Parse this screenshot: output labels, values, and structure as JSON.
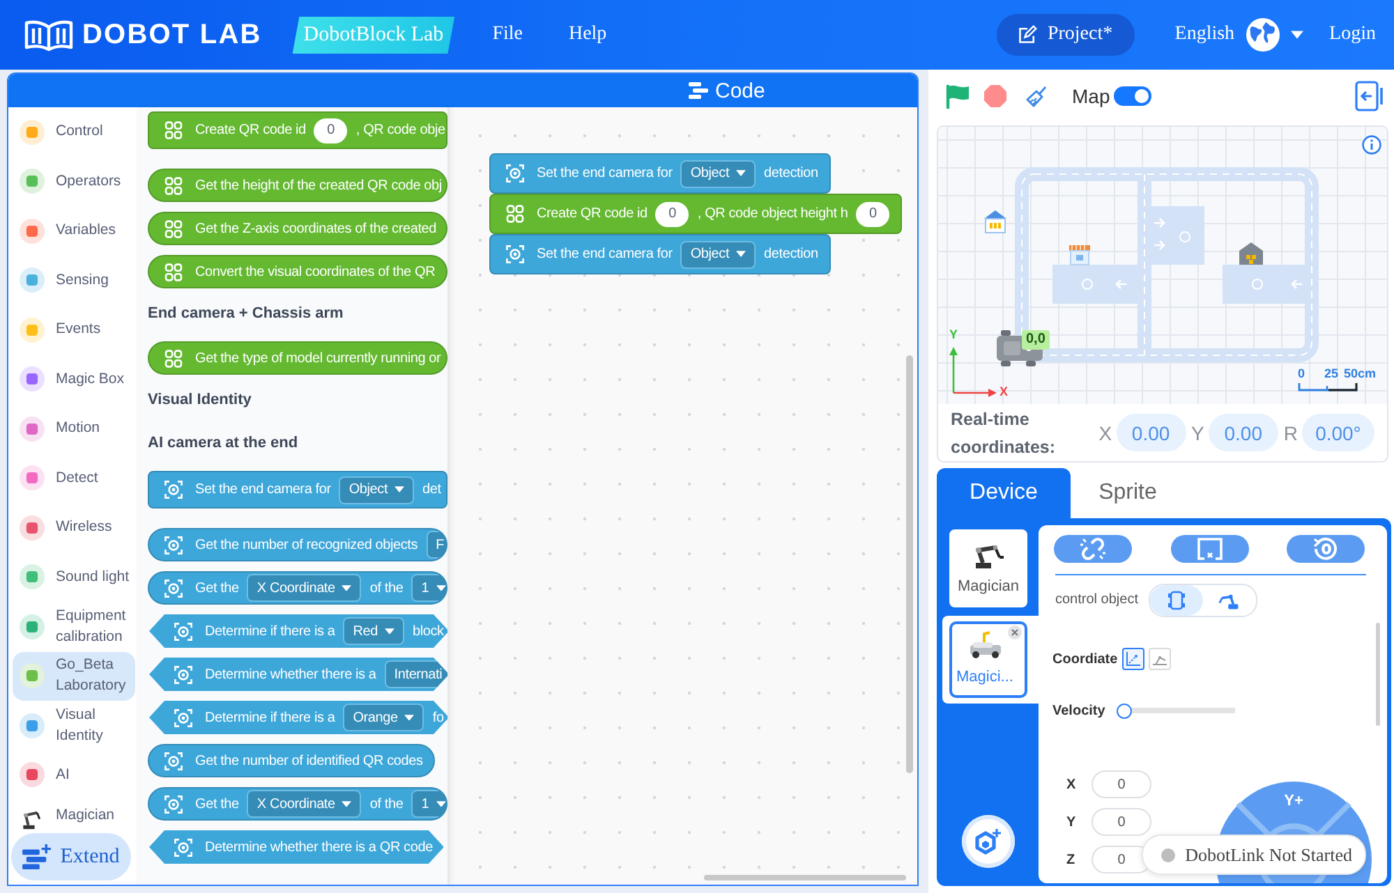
{
  "header": {
    "logo": "DOBOT LAB",
    "badge": "DobotBlock Lab",
    "menu": [
      {
        "label": "File"
      },
      {
        "label": "Help"
      }
    ],
    "project": "Project*",
    "language": "English",
    "login": "Login"
  },
  "code_panel": {
    "title": "Code"
  },
  "categories": [
    {
      "label": "Control",
      "kind": "badge",
      "color": "#ffab19",
      "selected": false
    },
    {
      "label": "Operators",
      "kind": "badge",
      "color": "#59c059",
      "selected": false
    },
    {
      "label": "Variables",
      "kind": "badge",
      "color": "#ff6b4a",
      "selected": false
    },
    {
      "label": "Sensing",
      "kind": "badge",
      "color": "#4cb0de",
      "selected": false
    },
    {
      "label": "Events",
      "kind": "badge",
      "color": "#ffbf1a",
      "selected": false
    },
    {
      "label": "Magic Box",
      "kind": "badge",
      "color": "#9966ff",
      "selected": false
    },
    {
      "label": "Motion",
      "kind": "badge",
      "color": "#e067c6",
      "selected": false
    },
    {
      "label": "Detect",
      "kind": "badge",
      "color": "#f26bc1",
      "selected": false
    },
    {
      "label": "Wireless",
      "kind": "badge",
      "color": "#e8546b",
      "selected": false
    },
    {
      "label": "Sound light",
      "kind": "badge",
      "color": "#3fbf7a",
      "selected": false
    },
    {
      "label": "Equipment calibration",
      "kind": "badge",
      "color": "#2db37a",
      "selected": false
    },
    {
      "label": "Go_Beta Laboratory",
      "kind": "badge",
      "color": "#6cc04a",
      "selected": true
    },
    {
      "label": "Visual Identity",
      "kind": "badge",
      "color": "#3d9ee8",
      "selected": false
    },
    {
      "label": "AI",
      "kind": "badge",
      "color": "#e8485f",
      "selected": false
    },
    {
      "label": "Magician",
      "kind": "robot",
      "selected": false
    }
  ],
  "extend_button": {
    "label": "Extend"
  },
  "palette": [
    {
      "kind": "qr_stack",
      "color": "#64b931",
      "parts": [
        {
          "kind": "text",
          "text": "Create QR code id"
        },
        {
          "kind": "number",
          "text": "0"
        },
        {
          "kind": "text",
          "text": ", QR code obje"
        }
      ]
    },
    {
      "kind": "qr_reporter",
      "color": "#64b931",
      "parts": [
        {
          "kind": "text",
          "text": "Get the height of the created QR code obj"
        }
      ]
    },
    {
      "kind": "qr_reporter",
      "color": "#64b931",
      "parts": [
        {
          "kind": "text",
          "text": "Get the Z-axis coordinates of the created"
        }
      ]
    },
    {
      "kind": "qr_reporter",
      "color": "#64b931",
      "parts": [
        {
          "kind": "text",
          "text": "Convert the visual coordinates of the QR"
        }
      ]
    },
    {
      "kind": "heading",
      "text": "End camera + Chassis arm"
    },
    {
      "kind": "qr_reporter",
      "color": "#64b931",
      "parts": [
        {
          "kind": "text",
          "text": "Get the type of model currently running or"
        }
      ]
    },
    {
      "kind": "heading",
      "text": "Visual Identity"
    },
    {
      "kind": "heading",
      "text": "AI camera at the end"
    },
    {
      "kind": "camera_stack",
      "color": "#3ea7da",
      "parts": [
        {
          "kind": "text",
          "text": "Set the end camera for"
        },
        {
          "kind": "dropdown",
          "text": "Object"
        },
        {
          "kind": "text",
          "text": "det"
        }
      ]
    },
    {
      "kind": "camera_reporter",
      "color": "#3ea7da",
      "parts": [
        {
          "kind": "text",
          "text": "Get the number of recognized objects"
        },
        {
          "kind": "dropdown_cut",
          "text": "F"
        }
      ]
    },
    {
      "kind": "camera_reporter",
      "color": "#3ea7da",
      "parts": [
        {
          "kind": "text",
          "text": "Get the"
        },
        {
          "kind": "dropdown",
          "text": "X Coordinate"
        },
        {
          "kind": "text",
          "text": "of the"
        },
        {
          "kind": "dropdown",
          "text": "1"
        }
      ]
    },
    {
      "kind": "camera_boolean",
      "color": "#3ea7da",
      "parts": [
        {
          "kind": "text",
          "text": "Determine if there is a"
        },
        {
          "kind": "dropdown",
          "text": "Red"
        },
        {
          "kind": "text",
          "text": "block"
        }
      ]
    },
    {
      "kind": "camera_boolean",
      "color": "#3ea7da",
      "parts": [
        {
          "kind": "text",
          "text": "Determine whether there is a"
        },
        {
          "kind": "dropdown_cut",
          "text": "Internati"
        }
      ]
    },
    {
      "kind": "camera_boolean",
      "color": "#3ea7da",
      "parts": [
        {
          "kind": "text",
          "text": "Determine if there is a"
        },
        {
          "kind": "dropdown",
          "text": "Orange"
        },
        {
          "kind": "text",
          "text": "fo"
        }
      ]
    },
    {
      "kind": "camera_reporter",
      "color": "#3ea7da",
      "parts": [
        {
          "kind": "text",
          "text": "Get the number of identified QR codes"
        }
      ]
    },
    {
      "kind": "camera_reporter",
      "color": "#3ea7da",
      "parts": [
        {
          "kind": "text",
          "text": "Get the"
        },
        {
          "kind": "dropdown",
          "text": "X Coordinate"
        },
        {
          "kind": "text",
          "text": "of the"
        },
        {
          "kind": "dropdown",
          "text": "1"
        }
      ]
    },
    {
      "kind": "camera_boolean",
      "color": "#3ea7da",
      "parts": [
        {
          "kind": "text",
          "text": "Determine whether there is a QR code"
        }
      ]
    }
  ],
  "script": [
    {
      "kind": "camera_stack",
      "color": "#3ea7da",
      "parts": [
        {
          "kind": "text",
          "text": "Set the end camera for"
        },
        {
          "kind": "dropdown",
          "text": "Object"
        },
        {
          "kind": "text",
          "text": "detection"
        }
      ]
    },
    {
      "kind": "qr_stack",
      "color": "#64b931",
      "parts": [
        {
          "kind": "text",
          "text": "Create QR code id"
        },
        {
          "kind": "number",
          "text": "0"
        },
        {
          "kind": "text",
          "text": ", QR code object height h"
        },
        {
          "kind": "number",
          "text": "0"
        }
      ]
    },
    {
      "kind": "camera_stack",
      "color": "#3ea7da",
      "parts": [
        {
          "kind": "text",
          "text": "Set the end camera for"
        },
        {
          "kind": "dropdown",
          "text": "Object"
        },
        {
          "kind": "text",
          "text": "detection"
        }
      ]
    }
  ],
  "stage": {
    "map_toggle": {
      "label": "Map",
      "on": true
    },
    "map": {
      "y_axis": "Y",
      "origin_label": "0,0",
      "x_axis": "X",
      "scale": [
        "0",
        "25",
        "50cm"
      ]
    },
    "coordinates": {
      "label": "Real-time coordinates:",
      "fields": [
        {
          "axis": "X",
          "value": "0.00"
        },
        {
          "axis": "Y",
          "value": "0.00"
        },
        {
          "axis": "R",
          "value": "0.00°"
        }
      ]
    }
  },
  "device_tabs": [
    {
      "label": "Device",
      "selected": true
    },
    {
      "label": "Sprite",
      "selected": false
    }
  ],
  "devices": [
    {
      "name": "Magician",
      "kind": "arm",
      "selected": false
    },
    {
      "name": "Magici...",
      "kind": "car",
      "selected": true
    }
  ],
  "control": {
    "object_label": "control object",
    "objects": [
      {
        "kind": "chassis",
        "selected": true
      },
      {
        "kind": "arm",
        "selected": false
      }
    ],
    "coordinate_label": "Coordiate",
    "coordinate_modes": [
      {
        "kind": "cartesian",
        "selected": true
      },
      {
        "kind": "joint",
        "selected": false
      }
    ],
    "velocity": {
      "label": "Velocity",
      "level": 0
    },
    "axes": [
      {
        "label": "X",
        "value": "0"
      },
      {
        "label": "Y",
        "value": "0"
      },
      {
        "label": "Z",
        "value": "0"
      }
    ],
    "joystick": {
      "label": "Y+"
    }
  },
  "toast": {
    "text": "DobotLink Not Started"
  }
}
